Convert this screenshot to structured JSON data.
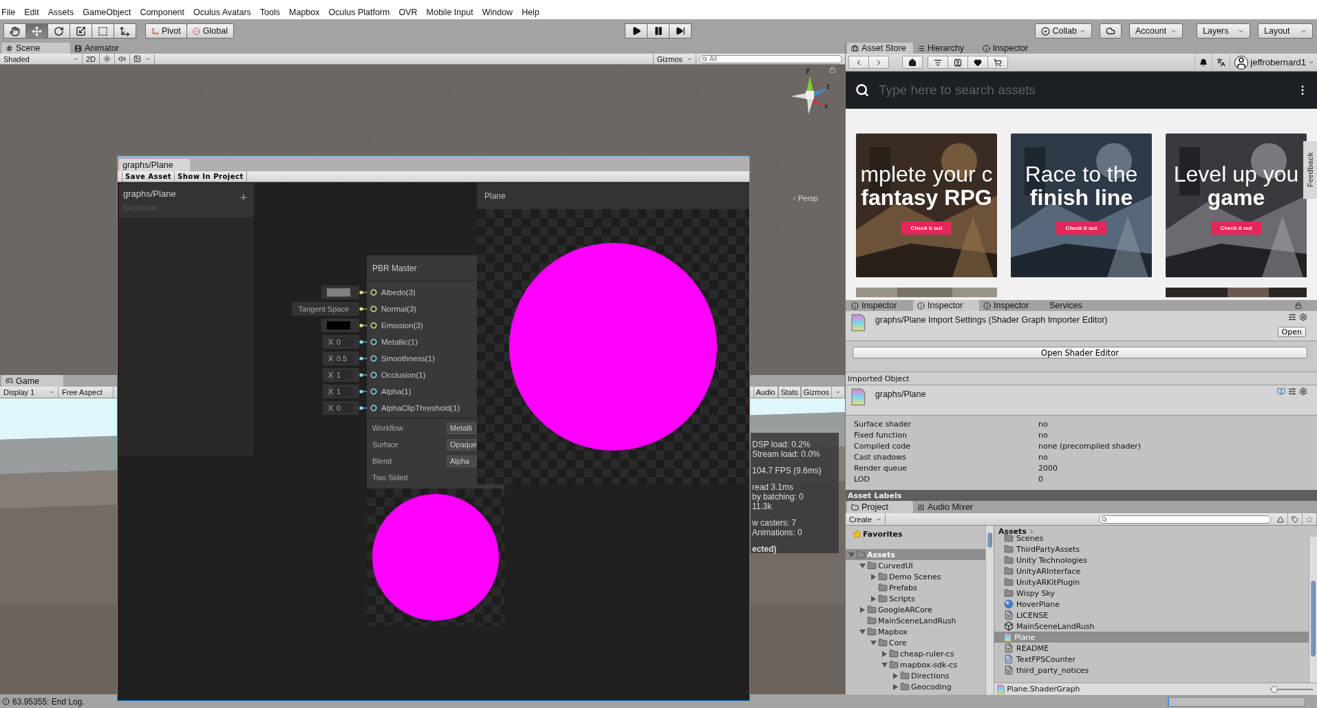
{
  "menu": [
    "File",
    "Edit",
    "Assets",
    "GameObject",
    "Component",
    "Oculus Avatars",
    "Tools",
    "Mapbox",
    "Oculus Platform",
    "OVR",
    "Mobile Input",
    "Window",
    "Help"
  ],
  "toolbar": {
    "transform_tools": [
      {
        "kind": "hand",
        "selected": false
      },
      {
        "kind": "move",
        "selected": true
      },
      {
        "kind": "rotate",
        "selected": false
      },
      {
        "kind": "scale",
        "selected": false
      },
      {
        "kind": "rect",
        "selected": false
      },
      {
        "kind": "transform",
        "selected": false
      }
    ],
    "pivot": "Pivot",
    "space": "Global",
    "playback": [
      {
        "kind": "play"
      },
      {
        "kind": "pause"
      },
      {
        "kind": "step"
      }
    ],
    "collab": "Collab",
    "account": "Account",
    "layers": "Layers",
    "layout": "Layout"
  },
  "scene": {
    "tabs": [
      {
        "label": "Scene",
        "kind": "scene",
        "selected": true
      },
      {
        "label": "Animator",
        "kind": "animator",
        "selected": false
      }
    ],
    "shading": "Shaded",
    "mode_2d": "2D",
    "gizmos": "Gizmos",
    "search_placeholder": "All",
    "axes": [
      "y",
      "z",
      "x"
    ],
    "projection": "Persp"
  },
  "game": {
    "tab": "Game",
    "display": "Display 1",
    "aspect": "Free Aspect",
    "buttons": [
      "Audio",
      "Stats",
      "Gizmos"
    ],
    "stats": [
      [
        "DSP load: 0.2%",
        "Stream load: 0.0%"
      ],
      [
        "104.7 FPS (9.6ms)"
      ],
      [
        "read 3.1ms",
        "by batching: 0",
        "11.3k"
      ],
      [
        "w casters: 7",
        "Animations: 0"
      ],
      [
        "ected)"
      ]
    ]
  },
  "shader_graph": {
    "tab": "graphs/Plane",
    "buttons": [
      "Save Asset",
      "Show In Project"
    ],
    "blackboard": {
      "title": "graphs/Plane",
      "subtitle": "Blackboard"
    },
    "master_node": {
      "title": "PBR Master",
      "ports": [
        {
          "label": "Albedo(3)",
          "color": "#e6df7a",
          "input": {
            "kind": "swatch",
            "color": "#808080"
          }
        },
        {
          "label": "Normal(3)",
          "color": "#e6df7a",
          "input": {
            "kind": "text",
            "text": "Tangent Space"
          }
        },
        {
          "label": "Emission(3)",
          "color": "#e6df7a",
          "input": {
            "kind": "swatch",
            "color": "#000000"
          }
        },
        {
          "label": "Metallic(1)",
          "color": "#84dce6",
          "input": {
            "kind": "number",
            "axis": "X",
            "value": "0"
          }
        },
        {
          "label": "Smoothness(1)",
          "color": "#84dce6",
          "input": {
            "kind": "number",
            "axis": "X",
            "value": "0.5"
          }
        },
        {
          "label": "Occlusion(1)",
          "color": "#84dce6",
          "input": {
            "kind": "number",
            "axis": "X",
            "value": "1"
          }
        },
        {
          "label": "Alpha(1)",
          "color": "#84dce6",
          "input": {
            "kind": "number",
            "axis": "X",
            "value": "1"
          }
        },
        {
          "label": "AlphaClipThreshold(1)",
          "color": "#84dce6",
          "input": {
            "kind": "number",
            "axis": "X",
            "value": "0"
          }
        }
      ],
      "settings": [
        {
          "label": "Workflow",
          "value": "Metalli"
        },
        {
          "label": "Surface",
          "value": "Opaque"
        },
        {
          "label": "Blend",
          "value": "Alpha"
        },
        {
          "label": "Two Sided"
        }
      ]
    },
    "preview": {
      "title": "Plane"
    }
  },
  "asset_store": {
    "tabs": [
      {
        "label": "Asset Store",
        "kind": "store",
        "selected": true
      },
      {
        "label": "Hierarchy",
        "kind": "hierarchy",
        "selected": false
      },
      {
        "label": "Inspector",
        "kind": "info",
        "selected": false
      }
    ],
    "user": "jeffrobernard1",
    "search_placeholder": "Type here to search assets",
    "banners": [
      {
        "kind": "rpg",
        "lines": [
          "mplete your c",
          "fantasy RPG"
        ],
        "button": "Check it out"
      },
      {
        "kind": "race",
        "lines": [
          "Race to the",
          "finish line"
        ],
        "button": "Check it out"
      },
      {
        "kind": "monster",
        "lines": [
          "Level up you",
          "game"
        ],
        "button": "Check it out"
      }
    ],
    "feedback": "Feedback"
  },
  "inspector": {
    "tabs": [
      {
        "label": "Inspector",
        "kind": "info",
        "selected": false
      },
      {
        "label": "Inspector",
        "kind": "info",
        "selected": true
      },
      {
        "label": "Inspector",
        "kind": "info",
        "selected": false
      },
      {
        "label": "Services",
        "kind": "plain",
        "selected": false
      }
    ],
    "title": "graphs/Plane Import Settings (Shader Graph Importer Editor)",
    "open": "Open",
    "open_editor": "Open Shader Editor",
    "section": "Imported Object",
    "object": "graphs/Plane",
    "properties": [
      {
        "label": "Surface shader",
        "value": "no"
      },
      {
        "label": "Fixed function",
        "value": "no"
      },
      {
        "label": "Compiled code",
        "value": "none (precompiled shader)"
      },
      {
        "label": "Cast shadows",
        "value": "no"
      },
      {
        "label": "Render queue",
        "value": "2000"
      },
      {
        "label": "LOD",
        "value": "0"
      }
    ],
    "labels_bar": "Asset Labels"
  },
  "project": {
    "tabs": [
      {
        "label": "Project",
        "kind": "folder",
        "selected": true
      },
      {
        "label": "Audio Mixer",
        "kind": "mixer",
        "selected": false
      }
    ],
    "create": "Create",
    "favorites": "Favorites",
    "tree": [
      {
        "label": "Assets",
        "expanded": true,
        "selected": true,
        "children": [
          {
            "label": "CurvedUI",
            "expanded": true,
            "selected": false,
            "children": [
              {
                "label": "Demo Scenes",
                "expanded": false,
                "selected": false
              },
              {
                "label": "Prefabs",
                "selected": false
              },
              {
                "label": "Scripts",
                "expanded": false,
                "selected": false
              }
            ]
          },
          {
            "label": "GoogleARCore",
            "expanded": false,
            "selected": false
          },
          {
            "label": "MainSceneLandRush",
            "selected": false
          },
          {
            "label": "Mapbox",
            "expanded": true,
            "selected": false,
            "children": [
              {
                "label": "Core",
                "expanded": true,
                "selected": false,
                "children": [
                  {
                    "label": "cheap-ruler-cs",
                    "expanded": false,
                    "selected": false
                  },
                  {
                    "label": "mapbox-sdk-cs",
                    "expanded": true,
                    "selected": false,
                    "children": [
                      {
                        "label": "Directions",
                        "expanded": false,
                        "selected": false
                      },
                      {
                        "label": "Geocoding",
                        "expanded": false,
                        "selected": false
                      }
                    ]
                  }
                ]
              }
            ]
          }
        ]
      }
    ],
    "breadcrumb": "Assets",
    "items": [
      {
        "label": "Scenes",
        "kind": "folder",
        "selected": false
      },
      {
        "label": "ThirdPartyAssets",
        "kind": "folder",
        "selected": false
      },
      {
        "label": "Unity Technologies",
        "kind": "folder",
        "selected": false
      },
      {
        "label": "UnityARInterface",
        "kind": "folder",
        "selected": false
      },
      {
        "label": "UnityARKitPlugin",
        "kind": "folder",
        "selected": false
      },
      {
        "label": "Wispy Sky",
        "kind": "folder",
        "selected": false
      },
      {
        "label": "HoverPlane",
        "kind": "sphere",
        "selected": false
      },
      {
        "label": "LICENSE",
        "kind": "text",
        "selected": false
      },
      {
        "label": "MainSceneLandRush",
        "kind": "scene",
        "selected": false
      },
      {
        "label": "Plane",
        "kind": "shader",
        "selected": true
      },
      {
        "label": "README",
        "kind": "text",
        "selected": false
      },
      {
        "label": "TextFPSCounter",
        "kind": "script",
        "selected": false
      },
      {
        "label": "third_party_notices",
        "kind": "text",
        "selected": false
      }
    ],
    "footer": "Plane.ShaderGraph",
    "zoom": {
      "level": 0
    }
  },
  "status_bar": {
    "message": "63.95355: End Log."
  }
}
